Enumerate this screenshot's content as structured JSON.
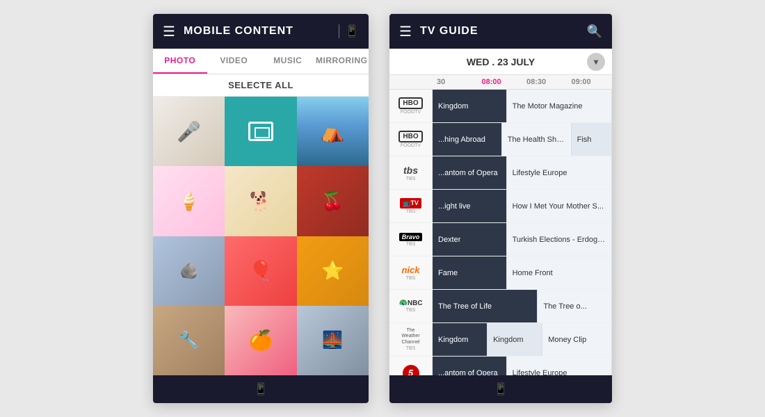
{
  "mobile": {
    "header": {
      "title": "MOBILE CONTENT",
      "icon_hint": "phone-cast-icon"
    },
    "tabs": [
      {
        "label": "PHOTO",
        "active": true
      },
      {
        "label": "VIDEO",
        "active": false
      },
      {
        "label": "MUSIC",
        "active": false
      },
      {
        "label": "MIRRORING",
        "active": false
      }
    ],
    "select_all": "SELECTE ALL",
    "photos": [
      {
        "type": "mic",
        "name": "microphone-photo"
      },
      {
        "type": "selected",
        "name": "selected-photo"
      },
      {
        "type": "tent",
        "name": "tent-photo"
      },
      {
        "type": "icecream",
        "name": "icecream-photo"
      },
      {
        "type": "dog",
        "name": "dog-photo"
      },
      {
        "type": "cherries",
        "name": "cherries-photo"
      },
      {
        "type": "stones",
        "name": "stones-photo"
      },
      {
        "type": "balloon",
        "name": "balloon-photo"
      },
      {
        "type": "starfish",
        "name": "starfish-photo"
      },
      {
        "type": "tools",
        "name": "tools-photo"
      },
      {
        "type": "grapefruit",
        "name": "grapefruit-photo"
      },
      {
        "type": "bridge",
        "name": "bridge-photo"
      }
    ],
    "footer_icon": "phone-icon"
  },
  "tv": {
    "header": {
      "title": "TV GUIDE",
      "icon_hint": "search-icon"
    },
    "date": "WED . 23 JULY",
    "times": [
      "30",
      "08:00",
      "08:30",
      "09:00"
    ],
    "channels": [
      {
        "name": "HBO",
        "sub": "FOODTV",
        "color": "hbo",
        "programs": [
          {
            "label": "Kingdom",
            "type": "dark",
            "flex": 2
          },
          {
            "label": "The Motor Magazine",
            "type": "light",
            "flex": 3
          }
        ]
      },
      {
        "name": "HBO",
        "sub": "FOODTV",
        "color": "hbo",
        "programs": [
          {
            "label": "...hing Abroad",
            "type": "dark",
            "flex": 2
          },
          {
            "label": "The Health Show",
            "type": "light",
            "flex": 2
          },
          {
            "label": "Fish",
            "type": "med",
            "flex": 1
          }
        ]
      },
      {
        "name": "tbs",
        "sub": "TBS",
        "color": "tbs",
        "programs": [
          {
            "label": "...antom of Opera",
            "type": "dark",
            "flex": 2
          },
          {
            "label": "Lifestyle Europe",
            "type": "light",
            "flex": 3
          }
        ]
      },
      {
        "name": "TV",
        "sub": "TBS",
        "color": "tv",
        "programs": [
          {
            "label": "...ight live",
            "type": "dark",
            "flex": 2
          },
          {
            "label": "How I Met Your Mother S...",
            "type": "light",
            "flex": 3
          }
        ]
      },
      {
        "name": "Bravo",
        "sub": "TBS",
        "color": "bravo",
        "programs": [
          {
            "label": "Dexter",
            "type": "dark",
            "flex": 2
          },
          {
            "label": "Turkish Elections - Erdogan P...",
            "type": "light",
            "flex": 3
          }
        ]
      },
      {
        "name": "nick",
        "sub": "TBS",
        "color": "nick",
        "programs": [
          {
            "label": "Fame",
            "type": "dark",
            "flex": 2
          },
          {
            "label": "Home Front",
            "type": "light",
            "flex": 3
          }
        ]
      },
      {
        "name": "NBC",
        "sub": "TBS",
        "color": "nbc",
        "programs": [
          {
            "label": "The Tree of Life",
            "type": "dark",
            "flex": 3
          },
          {
            "label": "The Tree o...",
            "type": "light",
            "flex": 2
          }
        ]
      },
      {
        "name": "Weather\nChannel",
        "sub": "TBS",
        "color": "weather",
        "programs": [
          {
            "label": "Kingdom",
            "type": "dark",
            "flex": 1
          },
          {
            "label": "Kingdom",
            "type": "med",
            "flex": 1
          },
          {
            "label": "Money Clip",
            "type": "light",
            "flex": 2
          }
        ]
      },
      {
        "name": "5",
        "sub": "",
        "color": "ch5",
        "programs": [
          {
            "label": "...antom of Opera",
            "type": "dark",
            "flex": 2
          },
          {
            "label": "Lifestyle Europe",
            "type": "light",
            "flex": 3
          }
        ]
      }
    ],
    "footer_icon": "phone-icon"
  }
}
